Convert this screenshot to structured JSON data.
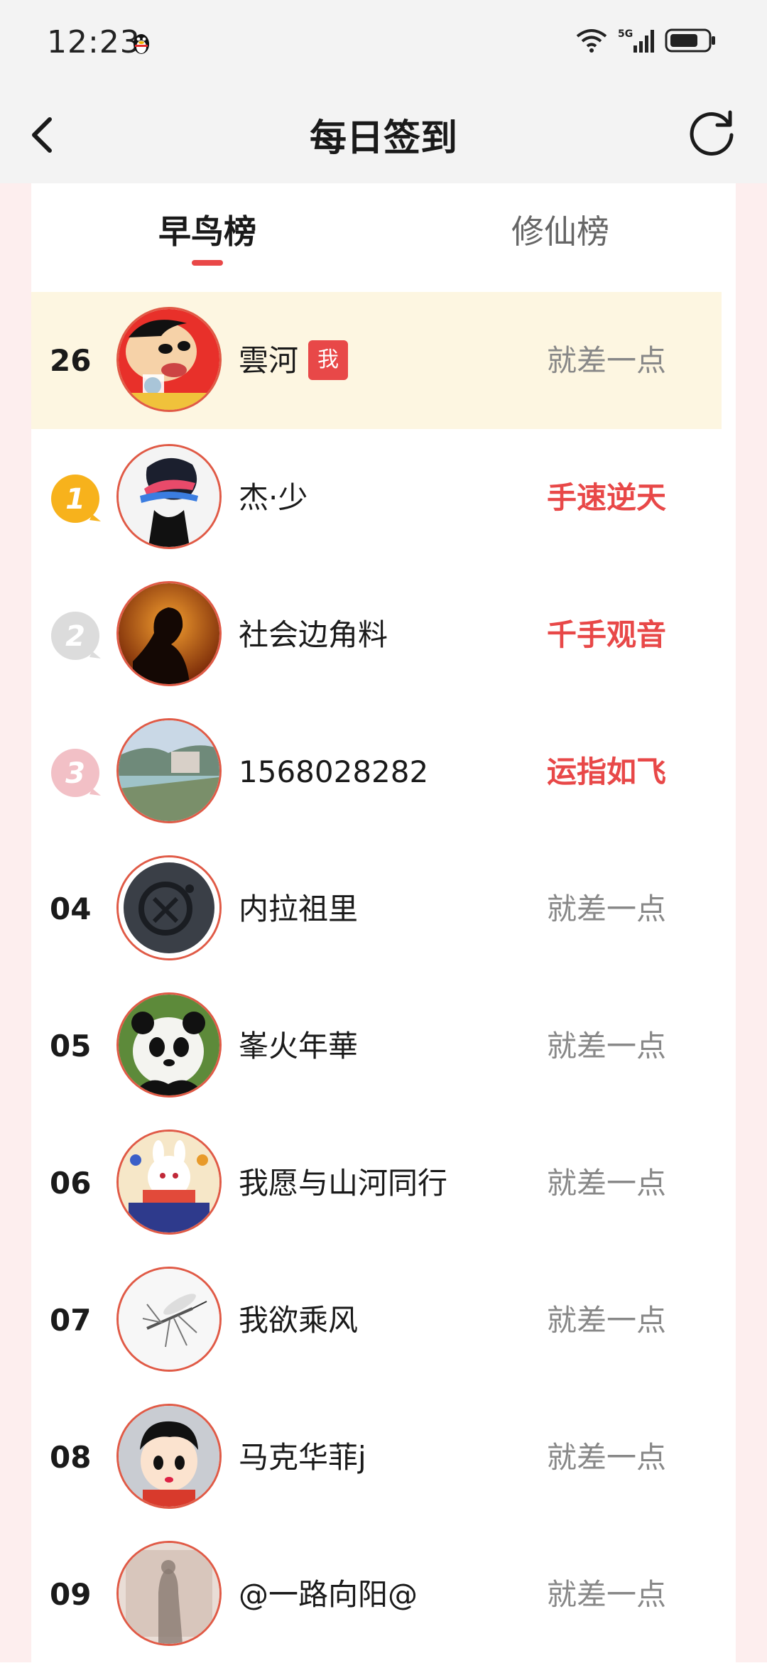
{
  "status_bar": {
    "time": "12:23",
    "network": "5G"
  },
  "header": {
    "title": "每日签到",
    "back_icon": "chevron-left-icon",
    "refresh_icon": "refresh-icon"
  },
  "tabs": [
    {
      "label": "早鸟榜",
      "active": true
    },
    {
      "label": "修仙榜",
      "active": false
    }
  ],
  "my_row": {
    "rank": "26",
    "name": "雲河",
    "badge": "我",
    "status": "就差一点"
  },
  "rows": [
    {
      "rank": "1",
      "medal": "gold",
      "name": "杰·少",
      "status": "手速逆天",
      "hot": true
    },
    {
      "rank": "2",
      "medal": "silver",
      "name": "社会边角料",
      "status": "千手观音",
      "hot": true
    },
    {
      "rank": "3",
      "medal": "bronze",
      "name": "1568028282",
      "status": "运指如飞",
      "hot": true
    },
    {
      "rank": "04",
      "name": "内拉祖里",
      "status": "就差一点",
      "hot": false
    },
    {
      "rank": "05",
      "name": "峯火年華",
      "status": "就差一点",
      "hot": false
    },
    {
      "rank": "06",
      "name": "我愿与山河同行",
      "status": "就差一点",
      "hot": false
    },
    {
      "rank": "07",
      "name": "我欲乘风",
      "status": "就差一点",
      "hot": false
    },
    {
      "rank": "08",
      "name": "马克华菲j",
      "status": "就差一点",
      "hot": false
    },
    {
      "rank": "09",
      "name": "@一路向阳@",
      "status": "就差一点",
      "hot": false
    }
  ],
  "colors": {
    "accent": "#e84848",
    "highlight_row": "#fdf6e1",
    "page_bg": "#fdeeee"
  }
}
